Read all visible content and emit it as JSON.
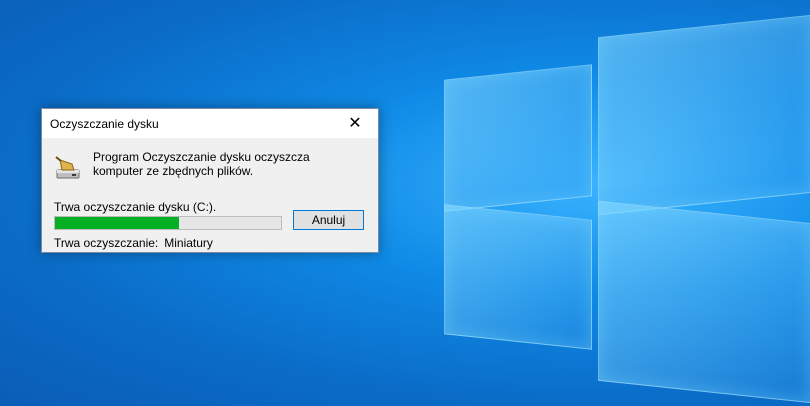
{
  "dialog": {
    "title": "Oczyszczanie dysku",
    "close_glyph": "✕",
    "message": "Program Oczyszczanie dysku oczyszcza komputer ze zbędnych plików.",
    "status": "Trwa oczyszczanie dysku  (C:).",
    "progress_percent": 55,
    "cancel_label": "Anuluj",
    "current_label": "Trwa oczyszczanie:",
    "current_value": "Miniatury",
    "icon": "disk-cleanup-icon"
  },
  "colors": {
    "progress_fill": "#06b025",
    "button_border": "#0078d7",
    "desktop": "#0a74d1"
  }
}
